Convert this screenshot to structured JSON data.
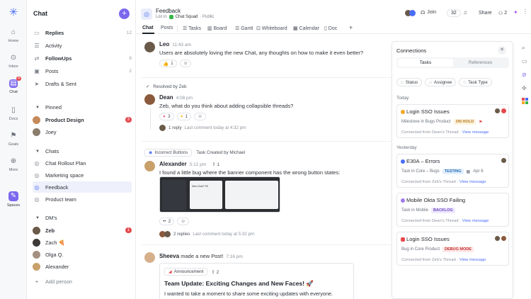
{
  "rail": {
    "items": [
      {
        "label": "Home",
        "icon": "home-icon"
      },
      {
        "label": "Inbox",
        "icon": "inbox-icon",
        "badge": "4"
      },
      {
        "label": "Chat",
        "icon": "chat-icon"
      },
      {
        "label": "Docs",
        "icon": "docs-icon"
      },
      {
        "label": "Goals",
        "icon": "goals-icon"
      },
      {
        "label": "More",
        "icon": "more-icon"
      },
      {
        "label": "Spaces",
        "icon": "spaces-icon"
      }
    ]
  },
  "sidebar": {
    "title": "Chat",
    "top_items": [
      {
        "label": "Replies",
        "count": "12",
        "bold": true
      },
      {
        "label": "Activity",
        "count": ""
      },
      {
        "label": "FollowUps",
        "count": "8",
        "bold": true
      },
      {
        "label": "Posts",
        "count": "2"
      },
      {
        "label": "Drafts & Sent",
        "count": ""
      }
    ],
    "pinned_label": "Pinned",
    "pinned": [
      {
        "label": "Product Design",
        "badge": "3"
      },
      {
        "label": "Joey",
        "badge": ""
      }
    ],
    "chats_label": "Chats",
    "chats": [
      {
        "label": "Chat Rollout Plan"
      },
      {
        "label": "Marketing space"
      },
      {
        "label": "Feedback"
      },
      {
        "label": "Product team"
      }
    ],
    "dms_label": "DM's",
    "dms": [
      {
        "label": "Zeb",
        "badge": "1"
      },
      {
        "label": "Zach 🍕",
        "badge": ""
      },
      {
        "label": "Olga Q.",
        "badge": ""
      },
      {
        "label": "Alexander",
        "badge": ""
      }
    ],
    "add_person": "Add person"
  },
  "header": {
    "title": "Feedback",
    "subtitle_prefix": "List in",
    "subtitle_space": "Chat Squad",
    "subtitle_suffix": "· Public",
    "join_label": "Join",
    "member_count": "32",
    "share_label": "Share",
    "share_count": "2"
  },
  "tabs": [
    "Chat",
    "Posts",
    "Tasks",
    "Board",
    "Gantt",
    "Whiteboard",
    "Calendar",
    "Doc"
  ],
  "feed": {
    "m1": {
      "name": "Leo",
      "time": "11:43 am",
      "text": "Users are absolutely loving the new Chat, any thoughts on how to make it even better?",
      "react": "👍",
      "react_count": "1"
    },
    "resolved": "Resolved by Zeb",
    "m2": {
      "name": "Dean",
      "time": "4:08 pm",
      "text": "Zeb, what do you think about adding collapsible threads?",
      "r1_count": "3",
      "r2_count": "1",
      "replies": "1 reply",
      "last": "Last comment today at 4:32 pm"
    },
    "m3": {
      "tag": "Incorrect Buttons",
      "tag2": "Task Created by Michael",
      "name": "Alexander",
      "time": "5:12 pm",
      "vote": "1",
      "text": "I found a little bug where the banner component has the wrong button states:",
      "react_count": "2",
      "replies": "2 replies",
      "last": "Last comment today at 5:32 pm",
      "mock_card": "New Chat? SS"
    },
    "m4": {
      "name": "Sheeva",
      "action": "made a new Post!",
      "time": "7:16 pm",
      "chip": "Announcement",
      "chip_count": "2",
      "post_title": "Team Update: Exciting Changes and New Faces! 🚀",
      "post_text": "I wanted to take a moment to share some exciting updates with everyone."
    }
  },
  "connections": {
    "title": "Connections",
    "tabs": [
      "Tasks",
      "References"
    ],
    "filters": [
      "Status",
      "Assignee",
      "Task Type"
    ],
    "today_label": "Today",
    "yesterday_label": "Yesterday",
    "cards": [
      {
        "title": "Login SSO Issues",
        "sub": "Milestone in Bugs Product",
        "pill": "ON HOLD",
        "pill_color": "#b7791f",
        "pill_bg": "#fdf3dc",
        "foot": "Connected from Dean's Thread",
        "link": "View message",
        "dot": "#f5a623"
      },
      {
        "title": "E30A – Errors",
        "sub": "Task in Core – Bugs",
        "pill": "TESTING",
        "pill_color": "#2b6cb0",
        "pill_bg": "#e3efff",
        "date": "Apr 6",
        "foot": "Connected from Zeb's Thread",
        "link": "View message",
        "dot": "#4a6cf7"
      },
      {
        "title": "Mobile Okta SSO Failing",
        "sub": "Task in Mobile",
        "pill": "BACKLOG",
        "pill_color": "#6b46c1",
        "pill_bg": "#efe9ff",
        "foot": "Connected from Dean's Thread",
        "link": "View message",
        "dot": "#9f7aea"
      },
      {
        "title": "Login SSO Issues",
        "sub": "Bug in Core Product",
        "pill": "DEBUG MODE",
        "pill_color": "#c53030",
        "pill_bg": "#fde8e8",
        "foot": "Connected from Zeb's Thread",
        "link": "View message",
        "dot": "#e5484d"
      }
    ]
  },
  "colors": {
    "accent": "#7b68ee",
    "red": "#e5484d",
    "link": "#4a6cf7"
  }
}
